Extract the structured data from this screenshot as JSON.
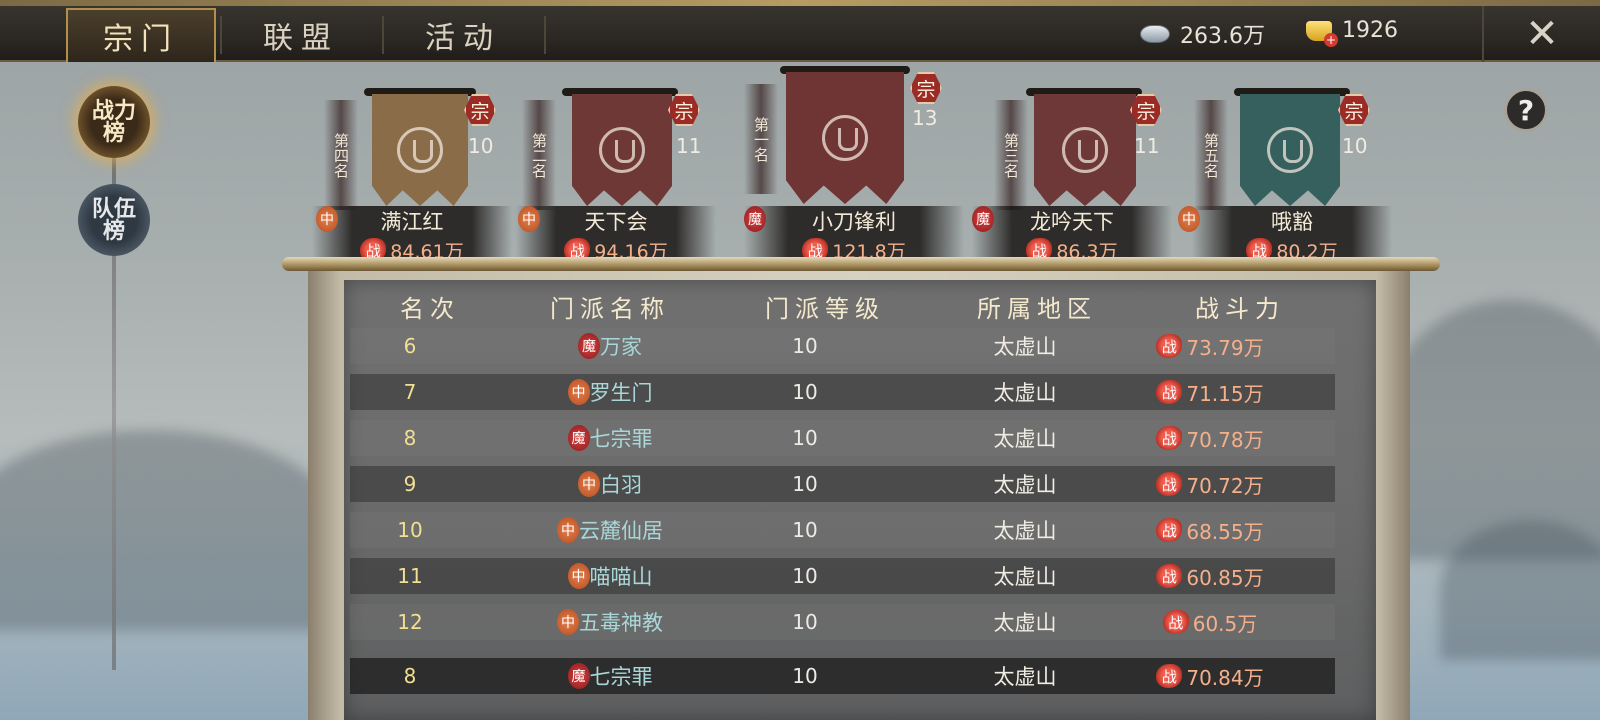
{
  "tabs": [
    {
      "label": "宗门",
      "active": true
    },
    {
      "label": "联盟",
      "active": false
    },
    {
      "label": "活动",
      "active": false
    }
  ],
  "resources": {
    "silver": "263.6万",
    "gold": "1926",
    "gold_plus": "+"
  },
  "close_glyph": "✕",
  "side": {
    "power_rank": "战力榜",
    "team_rank": "队伍榜"
  },
  "help": "?",
  "top5": [
    {
      "rank_label": "第四名",
      "level": "10",
      "faction": "中",
      "name": "满江红",
      "power": "84.61万",
      "banner_color": "#8a6d48"
    },
    {
      "rank_label": "第二名",
      "level": "11",
      "faction": "中",
      "name": "天下会",
      "power": "94.16万",
      "banner_color": "#6e3837"
    },
    {
      "rank_label": "第一名",
      "level": "13",
      "faction": "魔",
      "name": "小刀锋利",
      "power": "121.8万",
      "banner_color": "#6f3535"
    },
    {
      "rank_label": "第三名",
      "level": "11",
      "faction": "魔",
      "name": "龙吟天下",
      "power": "86.3万",
      "banner_color": "#6e3838"
    },
    {
      "rank_label": "第五名",
      "level": "10",
      "faction": "中",
      "name": "哦豁",
      "power": "80.2万",
      "banner_color": "#35605e"
    }
  ],
  "zong": "宗",
  "zhan": "战",
  "table": {
    "headers": [
      "名次",
      "门派名称",
      "门派等级",
      "所属地区",
      "战斗力"
    ],
    "rows": [
      {
        "rank": "6",
        "faction": "魔",
        "name": "万家",
        "level": "10",
        "region": "太虚山",
        "power": "73.79万"
      },
      {
        "rank": "7",
        "faction": "中",
        "name": "罗生门",
        "level": "10",
        "region": "太虚山",
        "power": "71.15万"
      },
      {
        "rank": "8",
        "faction": "魔",
        "name": "七宗罪",
        "level": "10",
        "region": "太虚山",
        "power": "70.78万"
      },
      {
        "rank": "9",
        "faction": "中",
        "name": "白羽",
        "level": "10",
        "region": "太虚山",
        "power": "70.72万"
      },
      {
        "rank": "10",
        "faction": "中",
        "name": "云麓仙居",
        "level": "10",
        "region": "太虚山",
        "power": "68.55万"
      },
      {
        "rank": "11",
        "faction": "中",
        "name": "喵喵山",
        "level": "10",
        "region": "太虚山",
        "power": "60.85万"
      },
      {
        "rank": "12",
        "faction": "中",
        "name": "五毒神教",
        "level": "10",
        "region": "太虚山",
        "power": "60.5万"
      }
    ],
    "self_row": {
      "rank": "8",
      "faction": "魔",
      "name": "七宗罪",
      "level": "10",
      "region": "太虚山",
      "power": "70.84万"
    }
  }
}
